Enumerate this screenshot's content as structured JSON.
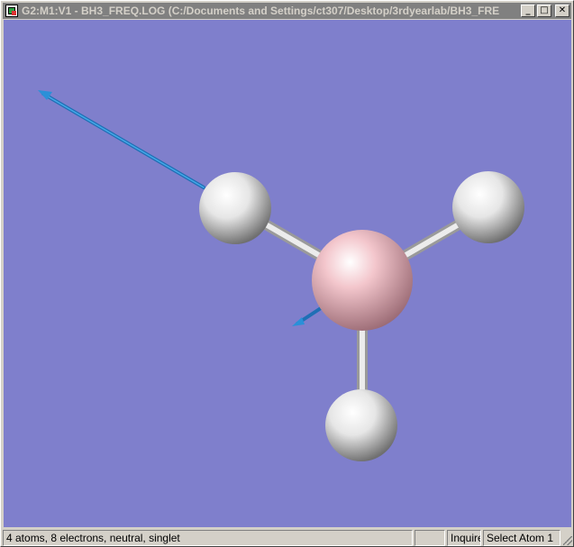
{
  "window": {
    "title": "G2:M1:V1 - BH3_FREQ.LOG (C:/Documents and Settings/ct307/Desktop/3rdyearlab/BH3_FRE",
    "minimize_glyph": "_",
    "maximize_glyph": "□",
    "close_glyph": "✕"
  },
  "viewer": {
    "background_color": "#7f7fcc",
    "molecule": {
      "atoms": [
        {
          "element": "B",
          "color": "#f0b8c0"
        },
        {
          "element": "H",
          "color": "#f2f2f2"
        },
        {
          "element": "H",
          "color": "#f2f2f2"
        },
        {
          "element": "H",
          "color": "#f2f2f2"
        }
      ],
      "bond_color": "#e0e0e0",
      "vector_color": "#1f7fd0"
    }
  },
  "status": {
    "main": "4 atoms, 8 electrons, neutral, singlet",
    "middle": "",
    "mode": "Inquire",
    "selection": "Select Atom 1"
  }
}
